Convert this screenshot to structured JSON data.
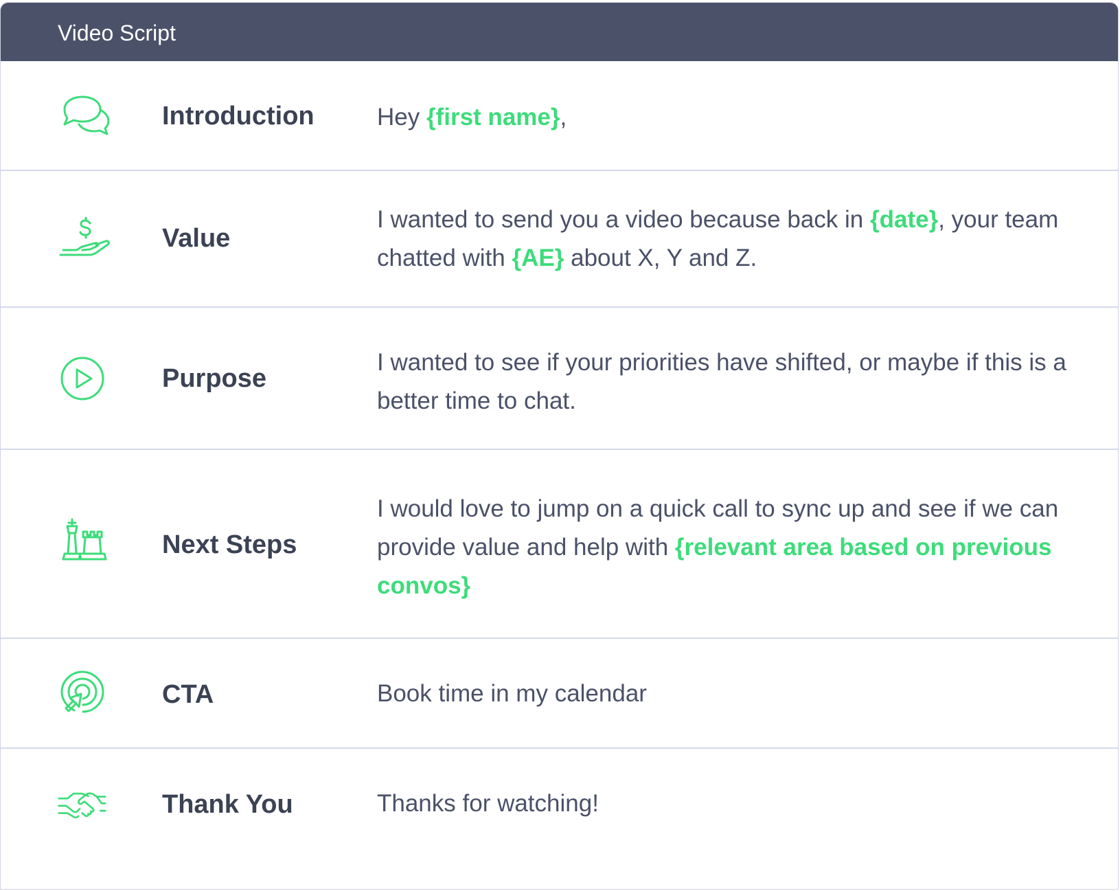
{
  "header": {
    "title": "Video Script"
  },
  "accent_color": "#3ddc7a",
  "header_color": "#4a5168",
  "rows": [
    {
      "icon": "chat-bubbles-icon",
      "label": "Introduction",
      "segments": [
        {
          "text": "Hey ",
          "highlight": false
        },
        {
          "text": "{first name}",
          "highlight": true
        },
        {
          "text": ",",
          "highlight": false
        }
      ]
    },
    {
      "icon": "hand-dollar-icon",
      "label": "Value",
      "segments": [
        {
          "text": "I wanted to send you a video because back in ",
          "highlight": false
        },
        {
          "text": "{date}",
          "highlight": true
        },
        {
          "text": ", your team chatted with ",
          "highlight": false
        },
        {
          "text": "{AE}",
          "highlight": true
        },
        {
          "text": " about X, Y and Z.",
          "highlight": false
        }
      ]
    },
    {
      "icon": "play-circle-icon",
      "label": "Purpose",
      "segments": [
        {
          "text": "I wanted to see if your priorities have shifted, or maybe if this is a better time to chat.",
          "highlight": false
        }
      ]
    },
    {
      "icon": "chess-pieces-icon",
      "label": "Next Steps",
      "segments": [
        {
          "text": "I would love to jump on a quick call to sync up and see if we can provide value and help with ",
          "highlight": false
        },
        {
          "text": "{relevant area based on previous convos}",
          "highlight": true
        }
      ]
    },
    {
      "icon": "target-cursor-icon",
      "label": "CTA",
      "segments": [
        {
          "text": "Book time in my calendar",
          "highlight": false
        }
      ]
    },
    {
      "icon": "handshake-icon",
      "label": "Thank You",
      "segments": [
        {
          "text": "Thanks for watching!",
          "highlight": false
        }
      ]
    }
  ]
}
